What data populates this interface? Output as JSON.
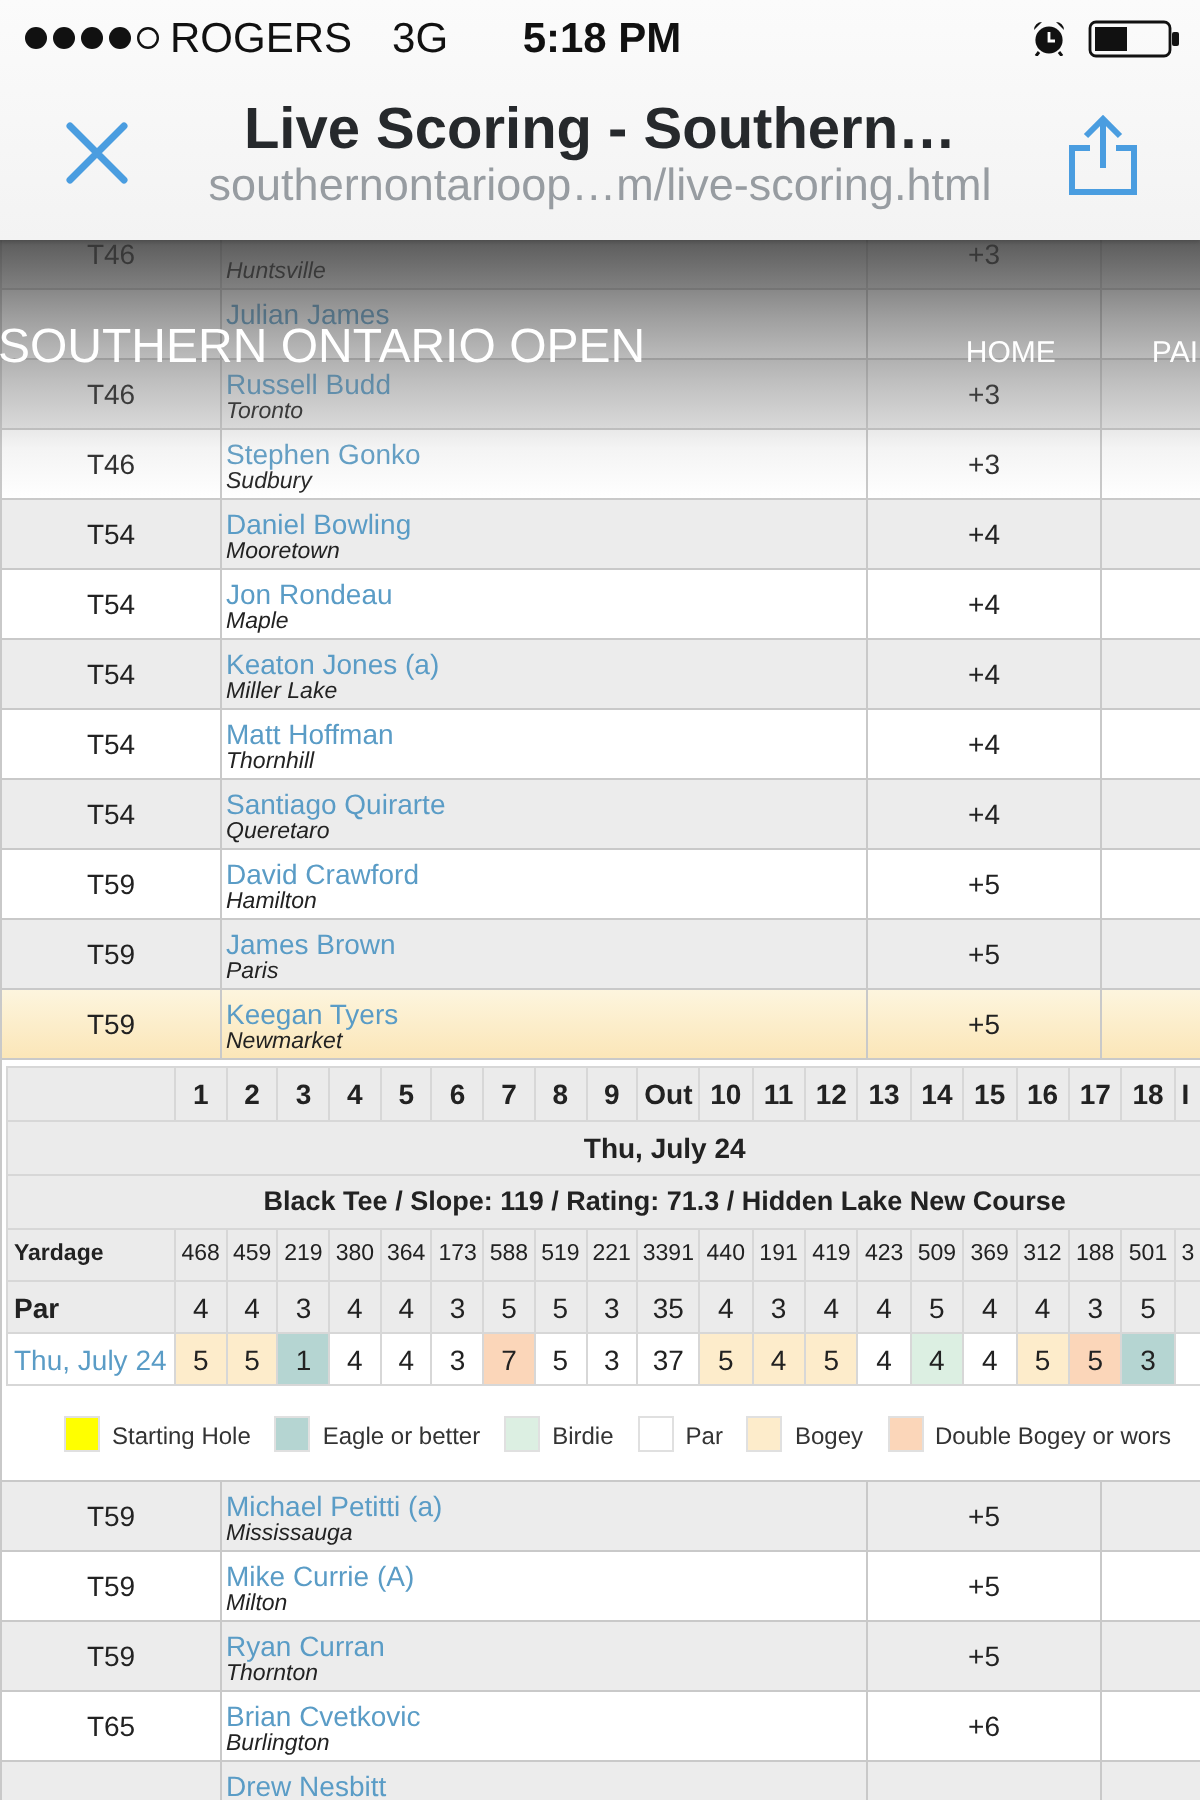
{
  "status_bar": {
    "carrier": "ROGERS",
    "network": "3G",
    "time": "5:18 PM"
  },
  "browser": {
    "title": "Live Scoring - Southern…",
    "url": "southernontarioop…m/live-scoring.html"
  },
  "site_nav": {
    "title": "SOUTHERN ONTARIO OPEN",
    "links": [
      "HOME",
      "PAI"
    ]
  },
  "leaderboard": {
    "rows": [
      {
        "rank": "T46",
        "city": "Huntsville",
        "score": "+3",
        "expanded": false
      },
      {
        "name": "Julian James",
        "expanded": false
      },
      {
        "rank": "T46",
        "name": "Russell Budd",
        "city": "Toronto",
        "score": "+3",
        "expanded": false
      },
      {
        "rank": "T46",
        "name": "Stephen Gonko",
        "city": "Sudbury",
        "score": "+3",
        "expanded": false
      },
      {
        "rank": "T54",
        "name": "Daniel Bowling",
        "city": "Mooretown",
        "score": "+4",
        "expanded": false
      },
      {
        "rank": "T54",
        "name": "Jon Rondeau",
        "city": "Maple",
        "score": "+4",
        "expanded": false
      },
      {
        "rank": "T54",
        "name": "Keaton Jones (a)",
        "city": "Miller Lake",
        "score": "+4",
        "expanded": false
      },
      {
        "rank": "T54",
        "name": "Matt Hoffman",
        "city": "Thornhill",
        "score": "+4",
        "expanded": false
      },
      {
        "rank": "T54",
        "name": "Santiago Quirarte",
        "city": "Queretaro",
        "score": "+4",
        "expanded": false
      },
      {
        "rank": "T59",
        "name": "David Crawford",
        "city": "Hamilton",
        "score": "+5",
        "expanded": false
      },
      {
        "rank": "T59",
        "name": "James Brown",
        "city": "Paris",
        "score": "+5",
        "expanded": false
      },
      {
        "rank": "T59",
        "name": "Keegan Tyers",
        "city": "Newmarket",
        "score": "+5",
        "expanded": true,
        "scorecard": {
          "date_heading": "Thu, July 24",
          "course_info": "Black Tee / Slope: 119 / Rating: 71.3 / Hidden Lake New Course",
          "labels": {
            "yardage": "Yardage",
            "par": "Par",
            "round": "Thu, July 24"
          },
          "holes": [
            {
              "hole": "1",
              "yardage": "468",
              "par": "4",
              "score": "5",
              "color": "#fdeccb"
            },
            {
              "hole": "2",
              "yardage": "459",
              "par": "4",
              "score": "5",
              "color": "#fdeccb"
            },
            {
              "hole": "3",
              "yardage": "219",
              "par": "3",
              "score": "1",
              "color": "#b5d5d2"
            },
            {
              "hole": "4",
              "yardage": "380",
              "par": "4",
              "score": "4",
              "color": "#ffffff"
            },
            {
              "hole": "5",
              "yardage": "364",
              "par": "4",
              "score": "4",
              "color": "#ffffff"
            },
            {
              "hole": "6",
              "yardage": "173",
              "par": "3",
              "score": "3",
              "color": "#ffffff"
            },
            {
              "hole": "7",
              "yardage": "588",
              "par": "5",
              "score": "7",
              "color": "#fbd6b9"
            },
            {
              "hole": "8",
              "yardage": "519",
              "par": "5",
              "score": "5",
              "color": "#ffffff"
            },
            {
              "hole": "9",
              "yardage": "221",
              "par": "3",
              "score": "3",
              "color": "#ffffff"
            },
            {
              "hole": "Out",
              "yardage": "3391",
              "par": "35",
              "score": "37",
              "color": "#ffffff"
            },
            {
              "hole": "10",
              "yardage": "440",
              "par": "4",
              "score": "5",
              "color": "#fdeccb"
            },
            {
              "hole": "11",
              "yardage": "191",
              "par": "3",
              "score": "4",
              "color": "#fdeccb"
            },
            {
              "hole": "12",
              "yardage": "419",
              "par": "4",
              "score": "5",
              "color": "#fdeccb"
            },
            {
              "hole": "13",
              "yardage": "423",
              "par": "4",
              "score": "4",
              "color": "#ffffff"
            },
            {
              "hole": "14",
              "yardage": "509",
              "par": "5",
              "score": "4",
              "color": "#dcefe2"
            },
            {
              "hole": "15",
              "yardage": "369",
              "par": "4",
              "score": "4",
              "color": "#ffffff"
            },
            {
              "hole": "16",
              "yardage": "312",
              "par": "4",
              "score": "5",
              "color": "#fdeccb"
            },
            {
              "hole": "17",
              "yardage": "188",
              "par": "3",
              "score": "5",
              "color": "#fbd6b9"
            },
            {
              "hole": "18",
              "yardage": "501",
              "par": "5",
              "score": "3",
              "color": "#b5d5d2"
            },
            {
              "hole": "I",
              "yardage": "3"
            }
          ],
          "legend": [
            {
              "label": "Starting Hole",
              "color": "#ffff00"
            },
            {
              "label": "Eagle or better",
              "color": "#b5d5d2"
            },
            {
              "label": "Birdie",
              "color": "#dcefe2"
            },
            {
              "label": "Par",
              "color": "#ffffff"
            },
            {
              "label": "Bogey",
              "color": "#fdeccb"
            },
            {
              "label": "Double Bogey or wors",
              "color": "#fbd6b9"
            }
          ]
        }
      },
      {
        "rank": "T59",
        "name": "Michael Petitti (a)",
        "city": "Mississauga",
        "score": "+5",
        "expanded": false
      },
      {
        "rank": "T59",
        "name": "Mike Currie (A)",
        "city": "Milton",
        "score": "+5",
        "expanded": false
      },
      {
        "rank": "T59",
        "name": "Ryan Curran",
        "city": "Thornton",
        "score": "+5",
        "expanded": false
      },
      {
        "rank": "T65",
        "name": "Brian Cvetkovic",
        "city": "Burlington",
        "score": "+6",
        "expanded": false
      },
      {
        "name": "Drew Nesbitt",
        "expanded": false
      }
    ]
  }
}
